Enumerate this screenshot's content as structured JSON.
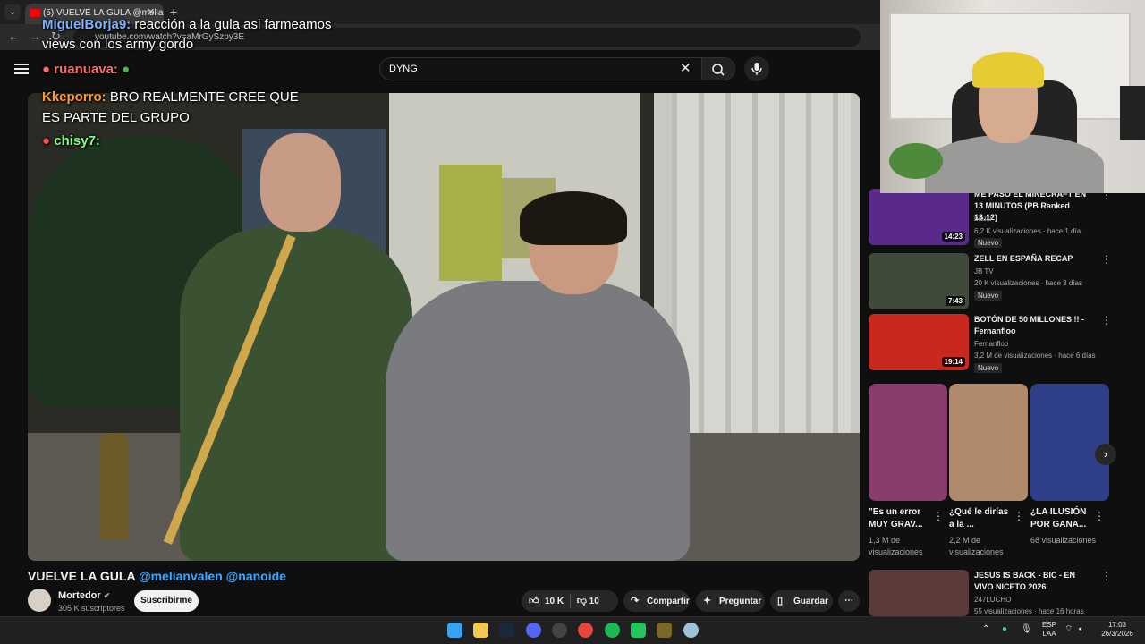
{
  "browser": {
    "tab_title": "(5) VUELVE LA GULA @melian...",
    "url": "youtube.com/watch?v=aMrGySzpy3E",
    "new_tab_glyph": "+",
    "close_glyph": "✕"
  },
  "search": {
    "query": "DYNG"
  },
  "chat": [
    {
      "user": "MiguelBorja9:",
      "user_color": "#7fb3ff",
      "message": " reacción a la gula asi farmeamos views con los army gordo"
    },
    {
      "user": "Kkeporro:",
      "user_color": "#ff9933",
      "message": " BRO REALMENTE CREE QUE ES PARTE DEL GRUPO"
    },
    {
      "user": "chisy7:",
      "user_color": "#7dff7d",
      "message": ""
    },
    {
      "user": "ruanuava:",
      "user_color": "#ff6b6b",
      "message": ""
    }
  ],
  "video": {
    "title": "VUELVE LA GULA",
    "mentions": "@melianvalen @nanoide",
    "channel": "Mortedor",
    "subscribers": "305 K suscriptores",
    "subscribe_label": "Suscribirme",
    "likes": "10 K",
    "dislikes": "10",
    "share_label": "Compartir",
    "ask_label": "Preguntar",
    "save_label": "Guardar"
  },
  "recommendations": [
    {
      "title": "ME PASO EL MINECRAFT EN 13 MINUTOS (PB Ranked 13:12)",
      "channel": "baulo",
      "meta": "6,2 K visualizaciones · hace 1 día",
      "duration": "14:23",
      "badge": "Nuevo",
      "thumb_color": "#5a2a8a"
    },
    {
      "title": "ZELL EN ESPAÑA RECAP",
      "channel": "JB TV",
      "meta": "20 K visualizaciones · hace 3 días",
      "duration": "7:43",
      "badge": "Nuevo",
      "thumb_color": "#3f4a3a"
    },
    {
      "title": "BOTÓN DE 50 MILLONES !! - Fernanfloo",
      "channel": "Fernanfloo",
      "meta": "3,2 M de visualizaciones · hace 6 días",
      "duration": "19:14",
      "badge": "Nuevo",
      "thumb_color": "#c8281e"
    },
    {
      "title": "JESUS IS BACK - BIC - EN VIVO NICETO 2026",
      "channel": "247LUCHO",
      "meta": "55 visualizaciones · hace 16 horas",
      "duration": "",
      "badge": "",
      "thumb_color": "#5b3a3a"
    }
  ],
  "shorts": [
    {
      "title": "\"Es un error MUY GRAV...",
      "views": "1,3 M de visualizaciones",
      "color": "#8a3d6b"
    },
    {
      "title": "¿Qué le dirías a la ...",
      "views": "2,2 M de visualizaciones",
      "color": "#b08a6a"
    },
    {
      "title": "¿LA ILUSIÓN POR GANA...",
      "views": "68 visualizaciones",
      "color": "#2f3f8a"
    }
  ],
  "taskbar": {
    "lang_top": "ESP",
    "lang_bottom": "LAA",
    "time": "17:03",
    "date": "26/3/2026"
  }
}
